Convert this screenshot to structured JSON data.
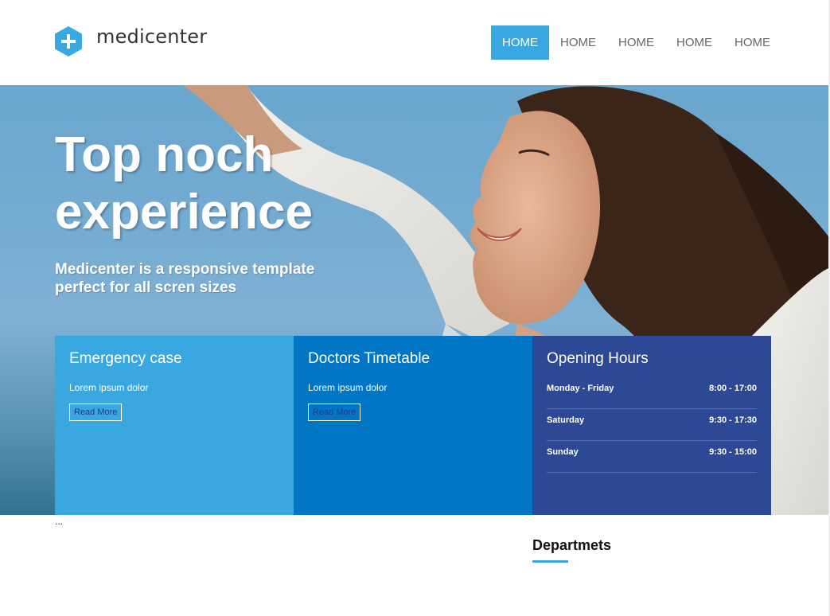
{
  "brand": {
    "name": "medicenter",
    "color": "#3aa8e0"
  },
  "nav": {
    "items": [
      {
        "label": "HOME",
        "active": true
      },
      {
        "label": "HOME",
        "active": false
      },
      {
        "label": "HOME",
        "active": false
      },
      {
        "label": "HOME",
        "active": false
      },
      {
        "label": "HOME",
        "active": false
      }
    ]
  },
  "hero": {
    "title": "Top noch experience",
    "subtitle": "Medicenter is a responsive template perfect for all scren sizes"
  },
  "boxes": {
    "emergency": {
      "title": "Emergency case",
      "text": "Lorem ipsum dolor",
      "button": "Read More"
    },
    "timetable": {
      "title": "Doctors Timetable",
      "text": "Lorem ipsum dolor",
      "button": "Read More"
    },
    "hours": {
      "title": "Opening Hours",
      "rows": [
        {
          "day": "Monday - Friday",
          "time": "8:00 - 17:00"
        },
        {
          "day": "Saturday",
          "time": "9:30 - 17:30"
        },
        {
          "day": "Sunday",
          "time": "9:30 - 15:00"
        }
      ]
    }
  },
  "content": {
    "ellipsis": "...",
    "departments_title": "Departmets"
  },
  "colors": {
    "light_blue": "#3aa8e0",
    "mid_blue": "#0176c5",
    "dark_blue": "#2d4895"
  }
}
